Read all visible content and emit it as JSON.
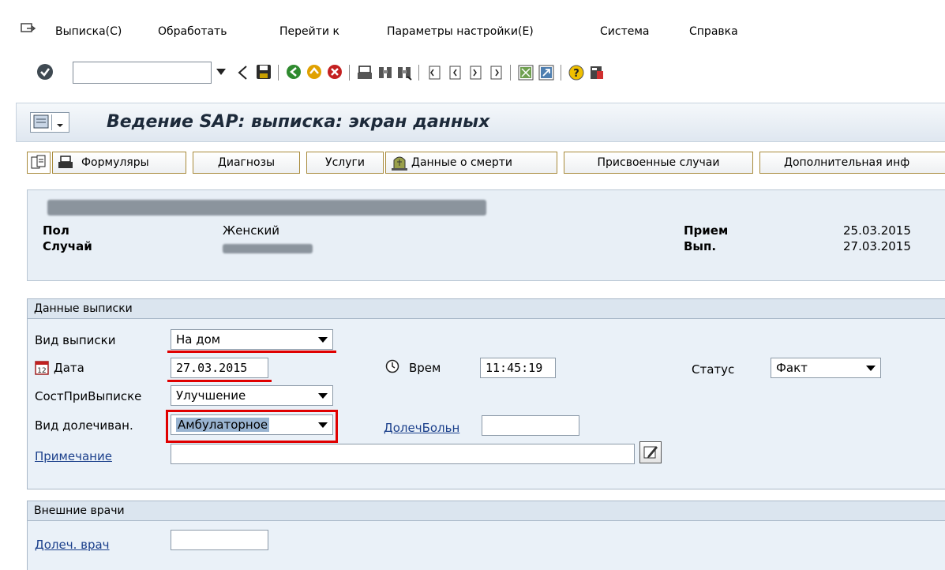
{
  "menu": {
    "items": [
      "Выписка(C)",
      "Обработать",
      "Перейти к",
      "Параметры настройки(E)",
      "Система",
      "Справка"
    ]
  },
  "toolbar": {
    "command_field_value": ""
  },
  "title": "Ведение SAP: выписка: экран данных",
  "app_buttons": {
    "forms": "Формуляры",
    "diagnoses": "Диагнозы",
    "services": "Услуги",
    "death_data": "Данные о смерти",
    "assigned_cases": "Присвоенные случаи",
    "additional": "Дополнительная инф"
  },
  "header": {
    "sex_label": "Пол",
    "sex_value": "Женский",
    "case_label": "Случай",
    "admission_label": "Прием",
    "admission_value": "25.03.2015",
    "discharge_label": "Вып.",
    "discharge_value": "27.03.2015"
  },
  "discharge_data": {
    "group_title": "Данные выписки",
    "type_label": "Вид выписки",
    "type_value": "На дом",
    "date_label": "Дата",
    "date_value": "27.03.2015",
    "time_label": "Врем",
    "time_value": "11:45:19",
    "status_label": "Статус",
    "status_value": "Факт",
    "condition_label": "СостПриВыписке",
    "condition_value": "Улучшение",
    "aftercare_label": "Вид долечиван.",
    "aftercare_value": "Амбулаторное",
    "aftercare_hospital_label": "ДолечБольн",
    "aftercare_hospital_value": "",
    "note_label": "Примечание",
    "note_value": ""
  },
  "external_doctors": {
    "group_title": "Внешние врачи",
    "doctor_label": "Долеч. врач",
    "doctor_value": ""
  },
  "colors": {
    "highlight_red": "#e00000",
    "title_gradient_top": "#f5f8fb",
    "panel_bg": "#eaf1f8"
  }
}
